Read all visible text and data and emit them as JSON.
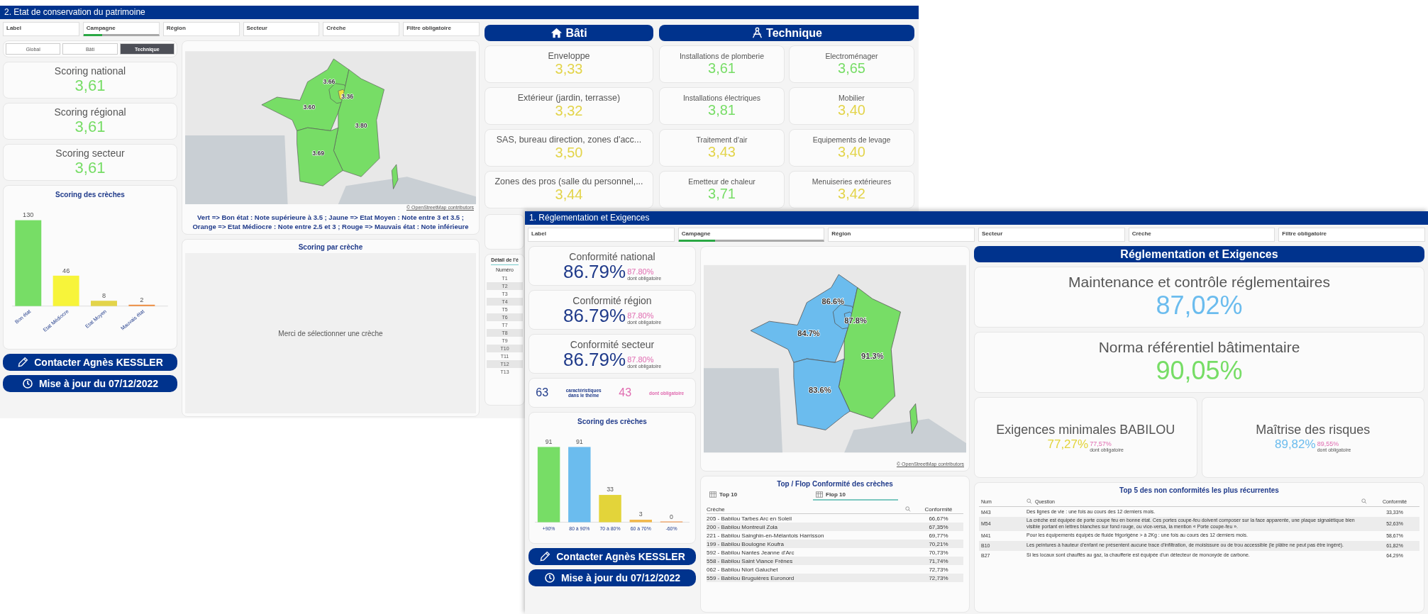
{
  "back_window": {
    "title": "2. Etat de conservation du patrimoine",
    "filters": [
      {
        "label": "Label",
        "selected": false
      },
      {
        "label": "Campagne",
        "selected": true
      },
      {
        "label": "Région",
        "selected": false
      },
      {
        "label": "Secteur",
        "selected": false
      },
      {
        "label": "Crèche",
        "selected": false
      },
      {
        "label": "Filtre obligatoire",
        "selected": false
      }
    ],
    "view_tabs": [
      {
        "label": "Global",
        "selected": false
      },
      {
        "label": "Bâti",
        "selected": false
      },
      {
        "label": "Technique",
        "selected": true
      }
    ],
    "scores": [
      {
        "label": "Scoring national",
        "value": "3,61",
        "color": "#77dd66"
      },
      {
        "label": "Scoring régional",
        "value": "3,61",
        "color": "#77dd66"
      },
      {
        "label": "Scoring secteur",
        "value": "3,61",
        "color": "#77dd66"
      }
    ],
    "scoring_chart": {
      "title": "Scoring des crèches",
      "chart_data": {
        "type": "bar",
        "categories": [
          "Bon état",
          "Etat Médiocre",
          "Etat Moyen",
          "Mauvais état"
        ],
        "values": [
          130,
          46,
          8,
          2
        ],
        "colors": [
          "#77dd66",
          "#f7f43a",
          "#e3d44a",
          "#ee8a3a"
        ],
        "data_labels": true
      }
    },
    "contact_button": "Contacter Agnès KESSLER",
    "update_button": "Mise à jour du 07/12/2022",
    "map": {
      "regions": [
        {
          "label": "3.60",
          "color": "#77dd66"
        },
        {
          "label": "3.66",
          "color": "#77dd66"
        },
        {
          "label": "3.36",
          "color": "#ecdf3f"
        },
        {
          "label": "3.80",
          "color": "#77dd66"
        },
        {
          "label": "3.69",
          "color": "#77dd66"
        }
      ],
      "attribution": "© OpenStreetMap contributors"
    },
    "map_legend": "Vert => Bon état : Note supérieure à 3.5 ; Jaune => Etat Moyen : Note entre 3 et 3.5 ; Orange => Etat Médiocre : Note entre 2.5 et 3 ; Rouge => Mauvais état : Note inférieure",
    "creche_panel": {
      "title": "Scoring par crèche",
      "message": "Merci de sélectionner une crèche"
    },
    "bati_header": "Bâti",
    "technique_header": "Technique",
    "bati_items": [
      {
        "label": "Enveloppe",
        "value": "3,33",
        "color": "#e3d44a"
      },
      {
        "label": "Extérieur (jardin, terrasse)",
        "value": "3,32",
        "color": "#e3d44a"
      },
      {
        "label": "SAS, bureau direction, zones d'acc...",
        "value": "3,50",
        "color": "#e3d44a"
      },
      {
        "label": "Zones des pros (salle du personnel,...",
        "value": "3,44",
        "color": "#e3d44a"
      }
    ],
    "technique_items": [
      {
        "label": "Installations de plomberie",
        "value": "3,61",
        "color": "#77dd66"
      },
      {
        "label": "Electroménager",
        "value": "3,65",
        "color": "#77dd66"
      },
      {
        "label": "Installations électriques",
        "value": "3,81",
        "color": "#77dd66"
      },
      {
        "label": "Mobilier",
        "value": "3,40",
        "color": "#e3d44a"
      },
      {
        "label": "Traitement d'air",
        "value": "3,43",
        "color": "#e3d44a"
      },
      {
        "label": "Equipements de levage",
        "value": "3,40",
        "color": "#e3d44a"
      },
      {
        "label": "Emetteur de chaleur",
        "value": "3,71",
        "color": "#77dd66"
      },
      {
        "label": "Menuiseries extérieures",
        "value": "3,42",
        "color": "#e3d44a"
      }
    ],
    "detail_panel": {
      "title": "Détail de l'é",
      "column": "Numéro",
      "rows": [
        "T1",
        "T2",
        "T3",
        "T4",
        "T5",
        "T6",
        "T7",
        "T8",
        "T9",
        "T10",
        "T11",
        "T12",
        "T13"
      ]
    }
  },
  "front_window": {
    "title": "1. Réglementation et Exigences",
    "filters": [
      {
        "label": "Label",
        "selected": false
      },
      {
        "label": "Campagne",
        "selected": true
      },
      {
        "label": "Région",
        "selected": false
      },
      {
        "label": "Secteur",
        "selected": false
      },
      {
        "label": "Crèche",
        "selected": false
      },
      {
        "label": "Filtre obligatoire",
        "selected": false
      }
    ],
    "conformity": [
      {
        "label": "Conformité national",
        "value": "86.79%",
        "mandatory": "87.80%",
        "mandatory_note": "dont obligatoire"
      },
      {
        "label": "Conformité région",
        "value": "86.79%",
        "mandatory": "87.80%",
        "mandatory_note": "dont obligatoire"
      },
      {
        "label": "Conformité secteur",
        "value": "86.79%",
        "mandatory": "87.80%",
        "mandatory_note": "dont obligatoire"
      }
    ],
    "counts": {
      "total": "63",
      "total_label": "caractéristiques dans le thème",
      "mandatory": "43",
      "mandatory_label": "dont obligatoire"
    },
    "scoring_chart": {
      "title": "Scoring des crèches",
      "chart_data": {
        "type": "bar",
        "categories": [
          "+90%",
          "80 à 90%",
          "70 à 80%",
          "60 à 70%",
          "-60%"
        ],
        "values": [
          91,
          91,
          33,
          3,
          0
        ],
        "colors": [
          "#77dd66",
          "#6bbcee",
          "#e3d43a",
          "#f2b84a",
          "#ee8a3a"
        ],
        "data_labels": true
      }
    },
    "contact_button": "Contacter Agnès KESSLER",
    "update_button": "Mise à jour du 07/12/2022",
    "map": {
      "regions": [
        {
          "label": "84.7%",
          "color": "#6bbcee"
        },
        {
          "label": "86.6%",
          "color": "#6bbcee"
        },
        {
          "label": "87.8%",
          "color": "#6bbcee"
        },
        {
          "label": "91.3%",
          "color": "#77dd66"
        },
        {
          "label": "83.6%",
          "color": "#6bbcee"
        }
      ],
      "attribution": "© OpenStreetMap contributors"
    },
    "top_flop": {
      "title": "Top / Flop Conformité des crèches",
      "tabs": [
        {
          "label": "Top 10",
          "selected": false
        },
        {
          "label": "Flop 10",
          "selected": true
        }
      ],
      "columns": [
        "Crèche",
        "Conformité"
      ],
      "rows": [
        [
          "205 - Babilou Tarbes Arc en Soleil",
          "66,67%"
        ],
        [
          "200 - Babilou Montreuil Zola",
          "67,35%"
        ],
        [
          "221 - Babilou Sainghin-en-Mélantois Harrisson",
          "69,77%"
        ],
        [
          "199 - Babilou Boulogne Koufra",
          "70,21%"
        ],
        [
          "592 - Babilou Nantes Jeanne d'Arc",
          "70,73%"
        ],
        [
          "558 - Babilou Saint Viance Frênes",
          "71,74%"
        ],
        [
          "062 - Babilou Niort Galuchet",
          "72,73%"
        ],
        [
          "559 - Babilou Bruguières Euronord",
          "72,73%"
        ]
      ]
    },
    "header": "Réglementation et Exigences",
    "main_scores": [
      {
        "label": "Maintenance et contrôle réglementaires",
        "value": "87,02%",
        "color": "#6bbcee"
      },
      {
        "label": "Norma référentiel bâtimentaire",
        "value": "90,05%",
        "color": "#77dd66"
      }
    ],
    "side_scores": [
      {
        "label": "Exigences minimales BABILOU",
        "value": "77,27%",
        "color": "#e3d43a",
        "mandatory": "77,57%",
        "mandatory_note": "dont obligatoire"
      },
      {
        "label": "Maîtrise des risques",
        "value": "89,82%",
        "color": "#6bbcee",
        "mandatory": "89,55%",
        "mandatory_note": "dont obligatoire"
      }
    ],
    "top5": {
      "title": "Top 5 des non conformités les plus récurrentes",
      "columns": [
        "Num",
        "Question",
        "Conformité"
      ],
      "rows": [
        [
          "M43",
          "Des lignes de vie : une fois au cours des 12 derniers mois.",
          "33,33%"
        ],
        [
          "M54",
          "La crèche est équipée de porte coupe feu en bonne état. Ces portes coupe-feu doivent composer sur la face apparente, une plaque signalétique bien visible portant en lettres blanches sur fond rouge, ou vice-versa, la mention « Porte coupe-feu ».",
          "52,63%"
        ],
        [
          "M41",
          "Pour les équipements équipés de fluide frigorigène > à 2Kg : une fois au cours des 12 derniers mois.",
          "58,67%"
        ],
        [
          "B10",
          "Les peintures à hauteur d'enfant ne présentent aucune trace d'infiltration, de moisissure ou de trou accessible (le plâtre ne peut pas être ingéré).",
          "61,82%"
        ],
        [
          "B27",
          "Si les locaux sont chauffés au gaz, la chaufferie est équipée d'un détecteur de monoxyde de carbone.",
          "64,29%"
        ]
      ]
    }
  }
}
